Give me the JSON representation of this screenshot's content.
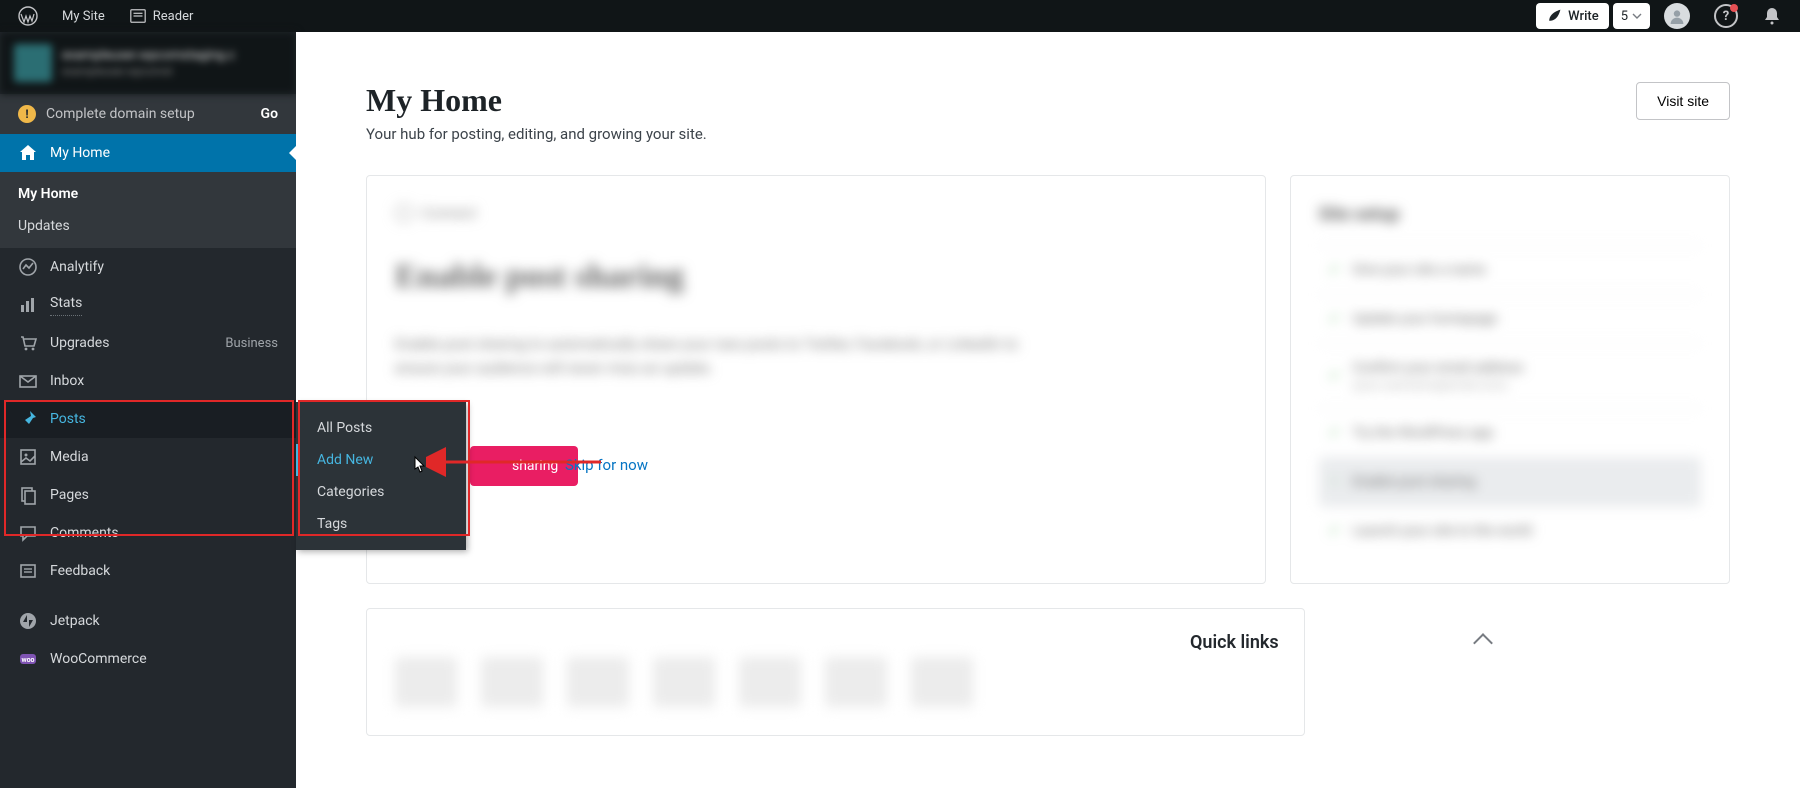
{
  "topbar": {
    "my_site": "My Site",
    "reader": "Reader",
    "write": "Write",
    "count": "5"
  },
  "sidebar": {
    "site_name": "exampleuser.wpcomstaging.c",
    "site_url": "exampleuser.wpcomst",
    "domain_setup": "Complete domain setup",
    "go": "Go",
    "items": {
      "my_home": "My Home",
      "my_home_sub": "My Home",
      "updates": "Updates",
      "analytify": "Analytify",
      "stats": "Stats",
      "upgrades": "Upgrades",
      "upgrades_plan": "Business",
      "inbox": "Inbox",
      "posts": "Posts",
      "media": "Media",
      "pages": "Pages",
      "comments": "Comments",
      "feedback": "Feedback",
      "jetpack": "Jetpack",
      "woocommerce": "WooCommerce"
    },
    "flyout": {
      "all_posts": "All Posts",
      "add_new": "Add New",
      "categories": "Categories",
      "tags": "Tags"
    }
  },
  "main": {
    "title": "My Home",
    "subtitle": "Your hub for posting, editing, and growing your site.",
    "visit": "Visit site",
    "card": {
      "step_label": "Connect",
      "big_title": "Enable post sharing",
      "body": "Enable post sharing to automatically share your new posts to Twitter, Facebook, or LinkedIn to ensure your audience will never miss an update.",
      "primary": "sharing",
      "skip": "Skip for now"
    },
    "setup": {
      "title": "Site setup",
      "item1": "Give your site a name",
      "item2": "Update your homepage",
      "item3": "Confirm your email address",
      "item3_sub": "(your-username@email.com)",
      "item4": "Try the WordPress app",
      "item5": "Enable post sharing",
      "item6": "Launch your site to the world"
    },
    "quicklinks": "Quick links"
  }
}
